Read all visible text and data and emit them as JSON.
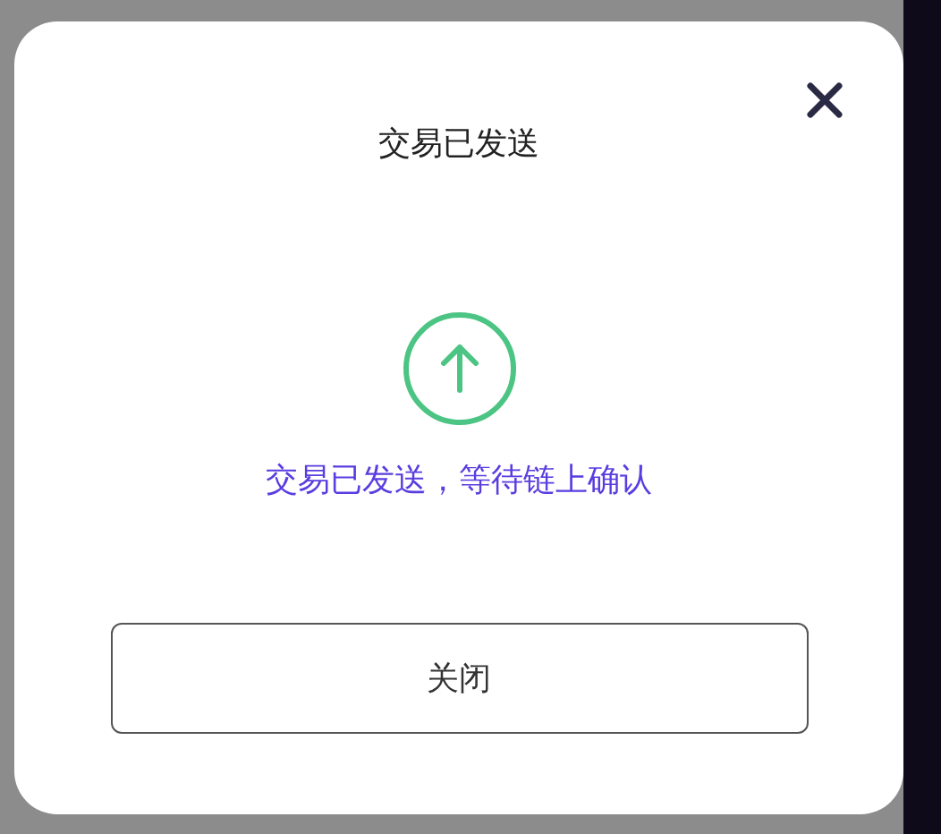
{
  "dialog": {
    "title": "交易已发送",
    "message": "交易已发送，等待链上确认",
    "buttons": [
      "关闭"
    ]
  }
}
